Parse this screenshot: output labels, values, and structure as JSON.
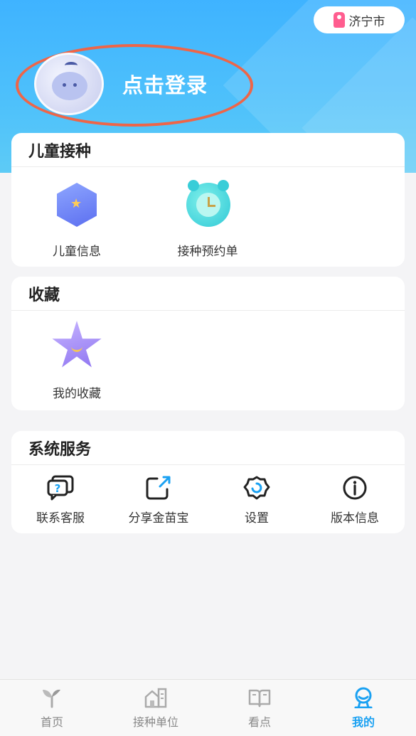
{
  "header": {
    "city": "济宁市",
    "login_text": "点击登录"
  },
  "children_vaccination": {
    "title": "儿童接种",
    "items": [
      {
        "label": "儿童信息",
        "icon": "medal-star-icon"
      },
      {
        "label": "接种预约单",
        "icon": "alarm-clock-icon"
      }
    ]
  },
  "favorites": {
    "title": "收藏",
    "items": [
      {
        "label": "我的收藏",
        "icon": "star-icon"
      }
    ]
  },
  "system_services": {
    "title": "系统服务",
    "items": [
      {
        "label": "联系客服",
        "icon": "chat-question-icon"
      },
      {
        "label": "分享金苗宝",
        "icon": "share-icon"
      },
      {
        "label": "设置",
        "icon": "gear-icon"
      },
      {
        "label": "版本信息",
        "icon": "info-icon"
      }
    ]
  },
  "tabbar": {
    "items": [
      {
        "label": "首页",
        "icon": "sprout-icon"
      },
      {
        "label": "接种单位",
        "icon": "building-icon"
      },
      {
        "label": "看点",
        "icon": "book-icon"
      },
      {
        "label": "我的",
        "icon": "profile-icon"
      }
    ],
    "active": "我的"
  },
  "colors": {
    "header_blue": "#3fb3ff",
    "accent_blue": "#1aa1f2",
    "highlight_red": "#ee6548"
  }
}
